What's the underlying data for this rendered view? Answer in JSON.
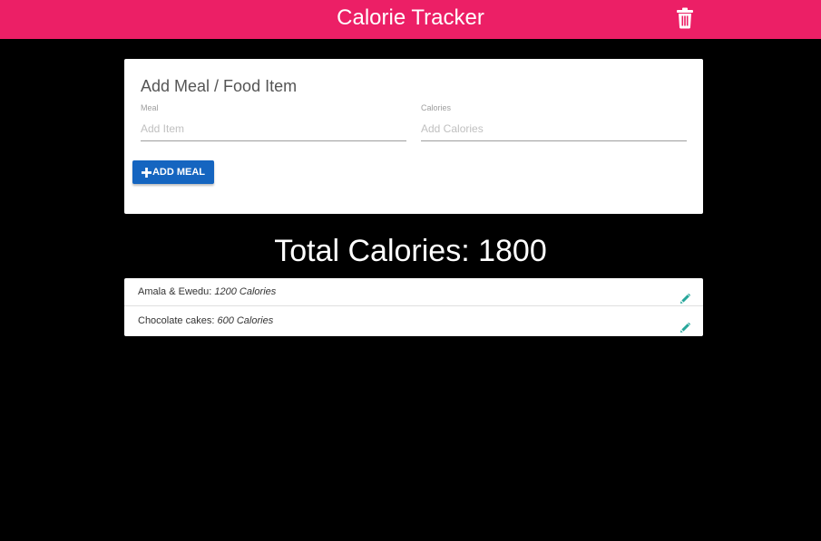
{
  "navbar": {
    "brand": "Calorie Tracker"
  },
  "form": {
    "title": "Add Meal / Food Item",
    "meal_label": "Meal",
    "meal_placeholder": "Add Item",
    "meal_value": "",
    "calories_label": "Calories",
    "calories_placeholder": "Add Calories",
    "calories_value": "",
    "add_button": "ADD MEAL"
  },
  "total": {
    "label": "Total Calories:",
    "value": "1800"
  },
  "items": [
    {
      "name": "Amala & Ewedu:",
      "calories": "1200 Calories"
    },
    {
      "name": "Chocolate cakes:",
      "calories": "600 Calories"
    }
  ],
  "colors": {
    "navbar": "#ec1f66",
    "button": "#1565c0",
    "edit_icon": "#26a69a",
    "background": "#000000"
  },
  "icons": {
    "clear": "trash-icon",
    "add": "plus-icon",
    "edit": "pencil-icon"
  }
}
